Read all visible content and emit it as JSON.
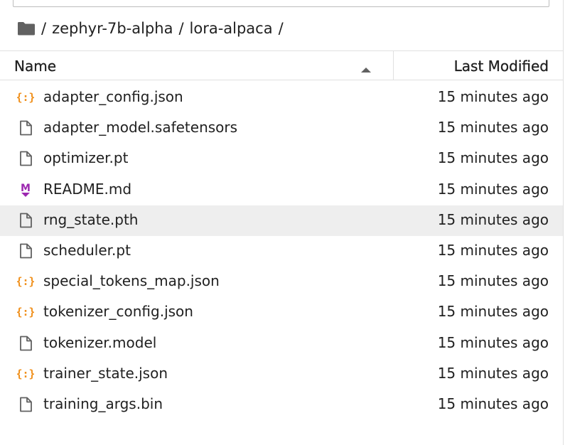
{
  "breadcrumb": {
    "root_sep": "/",
    "segments": [
      "zephyr-7b-alpha",
      "lora-alpaca"
    ],
    "separator": "/",
    "trailing_sep": "/"
  },
  "columns": {
    "name": "Name",
    "last_modified": "Last Modified",
    "sort": "ascending"
  },
  "colors": {
    "json_icon": "#f0901c",
    "md_icon": "#9c27b0",
    "file_icon": "#616161",
    "folder_icon": "#616161",
    "selected_row": "#eeeeee"
  },
  "files": [
    {
      "name": "adapter_config.json",
      "modified": "15 minutes ago",
      "icon": "json-icon"
    },
    {
      "name": "adapter_model.safetensors",
      "modified": "15 minutes ago",
      "icon": "file-icon"
    },
    {
      "name": "optimizer.pt",
      "modified": "15 minutes ago",
      "icon": "file-icon"
    },
    {
      "name": "README.md",
      "modified": "15 minutes ago",
      "icon": "markdown-icon"
    },
    {
      "name": "rng_state.pth",
      "modified": "15 minutes ago",
      "icon": "file-icon",
      "selected": true
    },
    {
      "name": "scheduler.pt",
      "modified": "15 minutes ago",
      "icon": "file-icon"
    },
    {
      "name": "special_tokens_map.json",
      "modified": "15 minutes ago",
      "icon": "json-icon"
    },
    {
      "name": "tokenizer_config.json",
      "modified": "15 minutes ago",
      "icon": "json-icon"
    },
    {
      "name": "tokenizer.model",
      "modified": "15 minutes ago",
      "icon": "file-icon"
    },
    {
      "name": "trainer_state.json",
      "modified": "15 minutes ago",
      "icon": "json-icon"
    },
    {
      "name": "training_args.bin",
      "modified": "15 minutes ago",
      "icon": "file-icon"
    }
  ]
}
